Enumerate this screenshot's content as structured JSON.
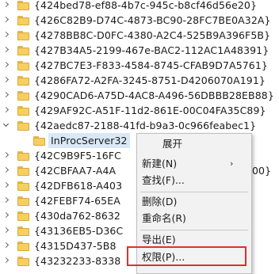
{
  "registry_keys": [
    {
      "label": "{424bed78-ef88-4b7c-945c-b8cf46d56e20}",
      "state": "collapsed"
    },
    {
      "label": "{426C82B9-D74C-4873-BC90-28FC7BE0A32A}",
      "state": "collapsed"
    },
    {
      "label": "{4278BB8C-D0FC-4380-A2C4-525B9A396F5B}",
      "state": "collapsed"
    },
    {
      "label": "{427B34A5-2199-467e-BAC2-112AC1A48391}",
      "state": "collapsed"
    },
    {
      "label": "{427BC7E3-F833-4584-8745-CFAB9D7A5761}",
      "state": "collapsed"
    },
    {
      "label": "{4286FA72-A2FA-3245-8751-D4206070A191}",
      "state": "collapsed"
    },
    {
      "label": "{4290CAD6-A75D-4AC8-A496-56DBBB28EB88}",
      "state": "collapsed"
    },
    {
      "label": "{429AF92C-A51F-11d2-861E-00C04FA35C89}",
      "state": "collapsed"
    },
    {
      "label": "{42aedc87-2188-41fd-b9a3-0c966feabec1}",
      "state": "expanded"
    },
    {
      "label": "InProcServer32",
      "state": "child"
    },
    {
      "label": "{42C9B9F5-16FC",
      "state": "collapsed"
    },
    {
      "label": "{42CBFAA7-A4A",
      "state": "collapsed",
      "tail": "00}"
    },
    {
      "label": "{42DFB618-A403",
      "state": "collapsed"
    },
    {
      "label": "{42FEBF74-65EA",
      "state": "collapsed"
    },
    {
      "label": "{430da762-8632",
      "state": "collapsed"
    },
    {
      "label": "{43136EB5-D36C",
      "state": "collapsed"
    },
    {
      "label": "{4315D437-5B8",
      "state": "collapsed"
    },
    {
      "label": "{43232233-8338",
      "state": "collapsed"
    }
  ],
  "context_menu": {
    "items": [
      {
        "label": "展开",
        "has_submenu": false
      },
      {
        "label": "新建(N)",
        "has_submenu": true
      },
      {
        "label": "查找(F)...",
        "has_submenu": false
      },
      {
        "label": "删除(D)",
        "has_submenu": false
      },
      {
        "label": "重命名(R)",
        "has_submenu": false
      },
      {
        "label": "导出(E)",
        "has_submenu": false
      },
      {
        "label": "权限(P)...",
        "has_submenu": false,
        "highlighted": true
      }
    ]
  },
  "colors": {
    "highlight_border": "#e0302a",
    "selection_background": "#d9e8f7",
    "folder_fill": "#f6cf60"
  },
  "icons": {
    "folder": "folder-icon",
    "collapsed": "chevron-right-icon",
    "expanded": "chevron-down-icon",
    "submenu": "chevron-right-icon"
  }
}
